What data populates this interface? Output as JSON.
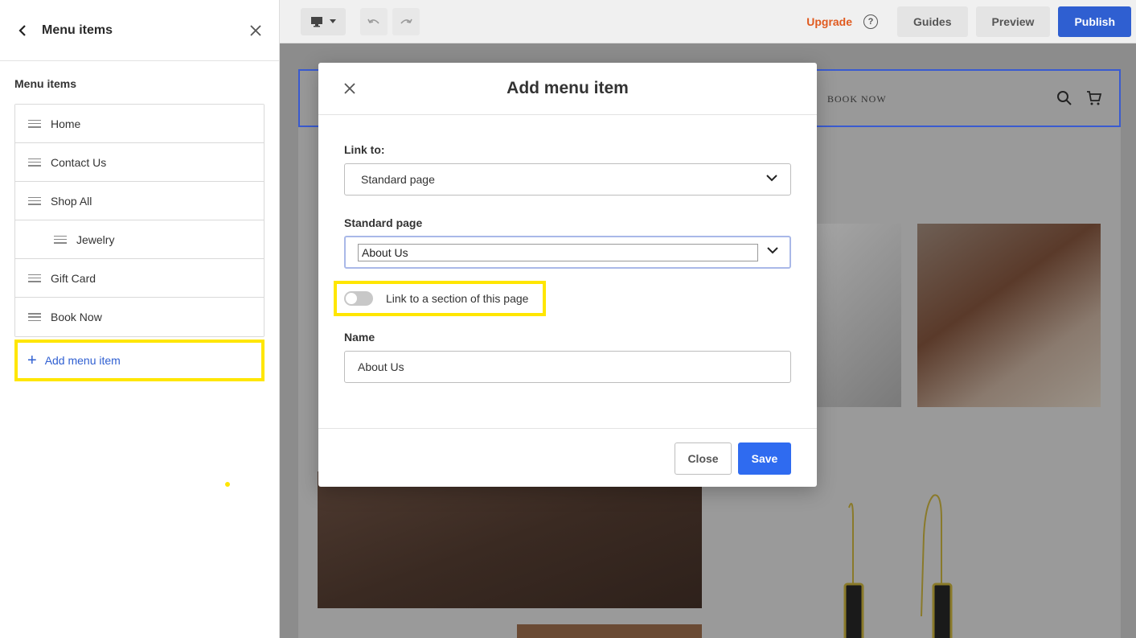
{
  "sidebar": {
    "title": "Menu items",
    "section_title": "Menu items",
    "items": [
      {
        "label": "Home"
      },
      {
        "label": "Contact Us"
      },
      {
        "label": "Shop All"
      },
      {
        "label": "Jewelry"
      },
      {
        "label": "Gift Card"
      },
      {
        "label": "Book Now"
      }
    ],
    "add_label": "Add menu item"
  },
  "topbar": {
    "upgrade": "Upgrade",
    "help": "?",
    "guides": "Guides",
    "preview": "Preview",
    "publish": "Publish"
  },
  "site": {
    "nav_book_now": "BOOK NOW"
  },
  "modal": {
    "title": "Add menu item",
    "link_to_label": "Link to:",
    "link_to_value": "Standard page",
    "standard_page_label": "Standard page",
    "standard_page_value": "About Us",
    "toggle_label": "Link to a section of this page",
    "toggle_on": false,
    "name_label": "Name",
    "name_value": "About Us",
    "close_button": "Close",
    "save_button": "Save"
  },
  "colors": {
    "accent": "#2f5fd1",
    "highlight": "#ffe600",
    "upgrade": "#e05a1f"
  }
}
